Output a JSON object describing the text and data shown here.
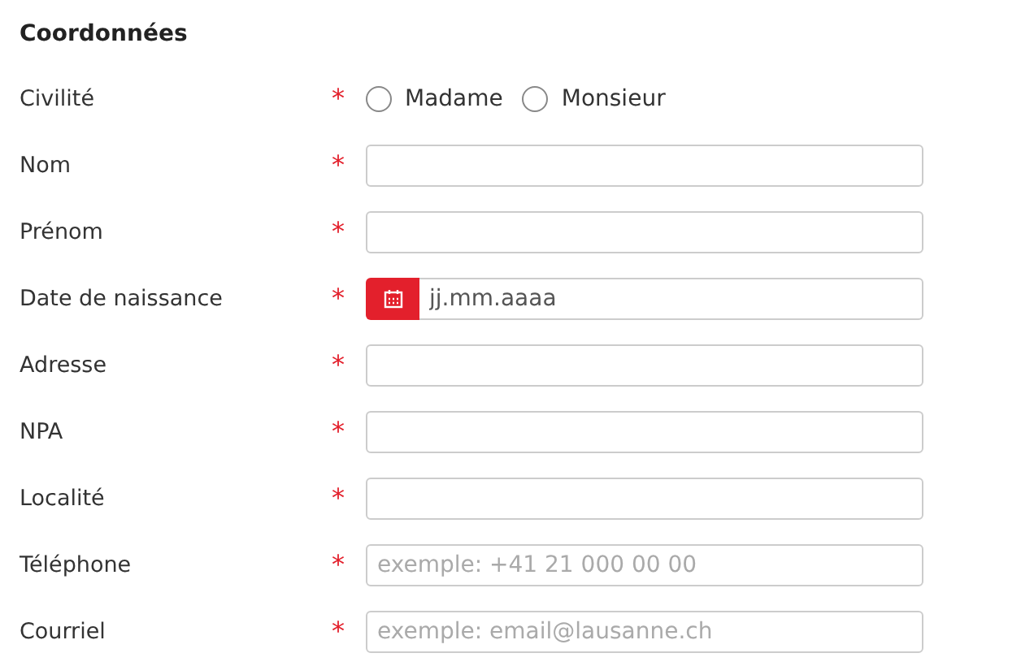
{
  "section": {
    "title": "Coordonnées"
  },
  "fields": [
    {
      "kind": "radio",
      "label": "Civilité",
      "required_mark": "*",
      "options": [
        {
          "label": "Madame",
          "selected": false
        },
        {
          "label": "Monsieur",
          "selected": false
        }
      ]
    },
    {
      "kind": "text",
      "label": "Nom",
      "required_mark": "*"
    },
    {
      "kind": "text",
      "label": "Prénom",
      "required_mark": "*"
    },
    {
      "kind": "date",
      "label": "Date de naissance",
      "required_mark": "*",
      "placeholder": "jj.mm.aaaa"
    },
    {
      "kind": "text",
      "label": "Adresse",
      "required_mark": "*"
    },
    {
      "kind": "text",
      "label": "NPA",
      "required_mark": "*"
    },
    {
      "kind": "text",
      "label": "Localité",
      "required_mark": "*"
    },
    {
      "kind": "text",
      "label": "Téléphone",
      "required_mark": "*",
      "placeholder": "exemple: +41 21 000 00 00"
    },
    {
      "kind": "text",
      "label": "Courriel",
      "required_mark": "*",
      "placeholder": "exemple: email@lausanne.ch"
    }
  ]
}
